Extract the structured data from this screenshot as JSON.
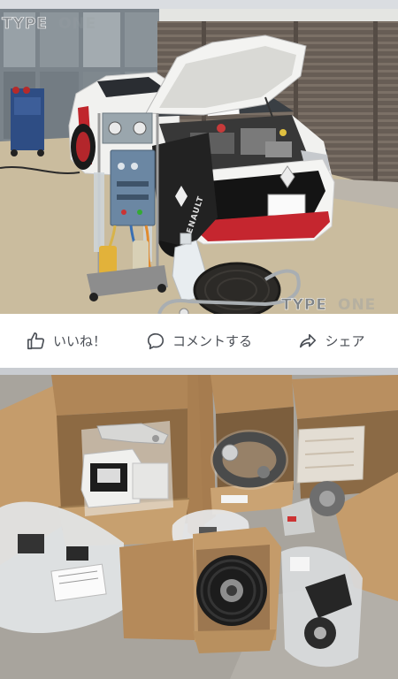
{
  "post": {
    "photo": {
      "watermark_top": {
        "word1": "TYPE",
        "word2": "ONE"
      },
      "watermark_bottom": {
        "word1": "TYPE",
        "word2": "ONE"
      },
      "fender_cover_text": "RENAULT"
    },
    "actions": [
      {
        "label": "いいね！",
        "icon": "thumbs-up-icon"
      },
      {
        "label": "コメントする",
        "icon": "comment-icon"
      },
      {
        "label": "シェア",
        "icon": "share-icon"
      }
    ]
  },
  "colors": {
    "action_text": "#4b4f56",
    "separator": "#c9ccd1",
    "top_strip": "#dadde1",
    "background": "#ffffff"
  }
}
